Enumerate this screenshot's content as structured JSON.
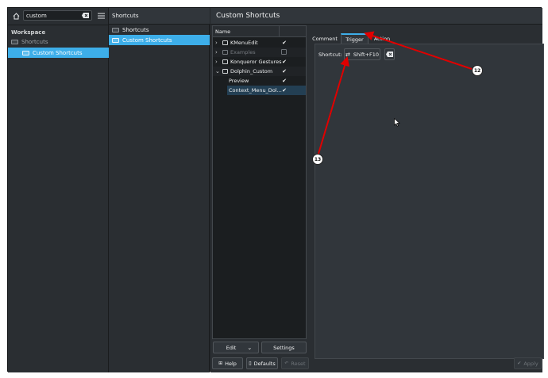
{
  "sidebar": {
    "search_value": "custom",
    "section_title": "Workspace",
    "items": [
      {
        "label": "Shortcuts"
      },
      {
        "label": "Custom Shortcuts"
      }
    ]
  },
  "midcol": {
    "header": "Shortcuts",
    "items": [
      {
        "label": "Shortcuts"
      },
      {
        "label": "Custom Shortcuts"
      }
    ]
  },
  "main": {
    "title": "Custom Shortcuts",
    "tree": {
      "column_name": "Name",
      "rows": [
        {
          "label": "KMenuEdit",
          "checked": true
        },
        {
          "label": "Examples",
          "checked": false
        },
        {
          "label": "Konqueror Gestures",
          "checked": true
        },
        {
          "label": "Dolphin_Custom",
          "checked": true
        },
        {
          "label": "Preview",
          "checked": true
        },
        {
          "label": "Context_Menu_Dol...",
          "checked": true
        }
      ]
    },
    "edit_button": "Edit",
    "settings_button": "Settings",
    "tabs": [
      {
        "label": "Comment"
      },
      {
        "label": "Trigger"
      },
      {
        "label": "Action"
      }
    ],
    "shortcut_label": "Shortcut:",
    "shortcut_value": "Shift+F10",
    "footer": {
      "help": "Help",
      "defaults": "Defaults",
      "reset": "Reset",
      "apply": "Apply"
    }
  },
  "annotations": {
    "callout_a": "12",
    "callout_b": "13",
    "arrow_color": "#e00000"
  },
  "colors": {
    "accent": "#3daee9",
    "window_bg": "#232629"
  }
}
